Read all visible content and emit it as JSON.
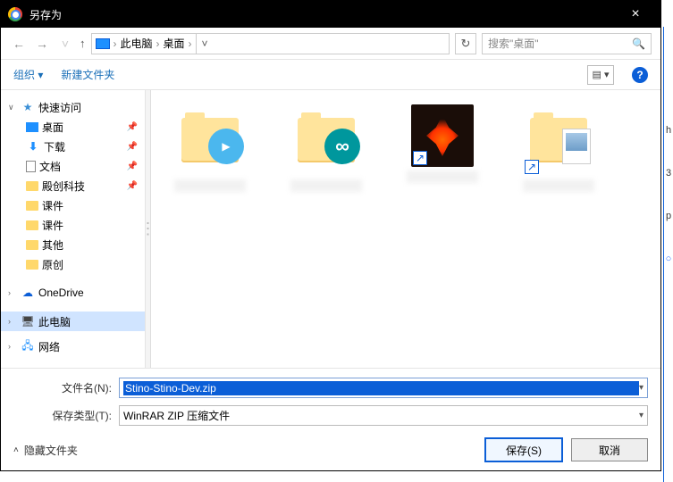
{
  "titlebar": {
    "title": "另存为",
    "close": "×"
  },
  "nav": {
    "path_root": "此电脑",
    "path_leaf": "桌面",
    "sep": "›",
    "search_placeholder": "搜索\"桌面\"",
    "refresh": "↻",
    "dropdown": "˅"
  },
  "toolbar": {
    "organize": "组织",
    "new_folder": "新建文件夹",
    "view": "▤ ▾",
    "help": "?"
  },
  "sidebar": {
    "quick": "快速访问",
    "desktop": "桌面",
    "downloads": "下载",
    "documents": "文档",
    "f1": "殿创科技",
    "f2": "课件",
    "f3": "课件",
    "f4": "其他",
    "f5": "原创",
    "onedrive": "OneDrive",
    "thispc": "此电脑",
    "network": "网络"
  },
  "footer": {
    "filename_label": "文件名(N):",
    "filename_value": "Stino-Stino-Dev.zip",
    "filetype_label": "保存类型(T):",
    "filetype_value": "WinRAR ZIP 压缩文件",
    "hide": "隐藏文件夹",
    "save": "保存(S)",
    "cancel": "取消"
  },
  "edge": {
    "c1": "h",
    "c2": "3",
    "c3": "p",
    "c4": "○"
  }
}
